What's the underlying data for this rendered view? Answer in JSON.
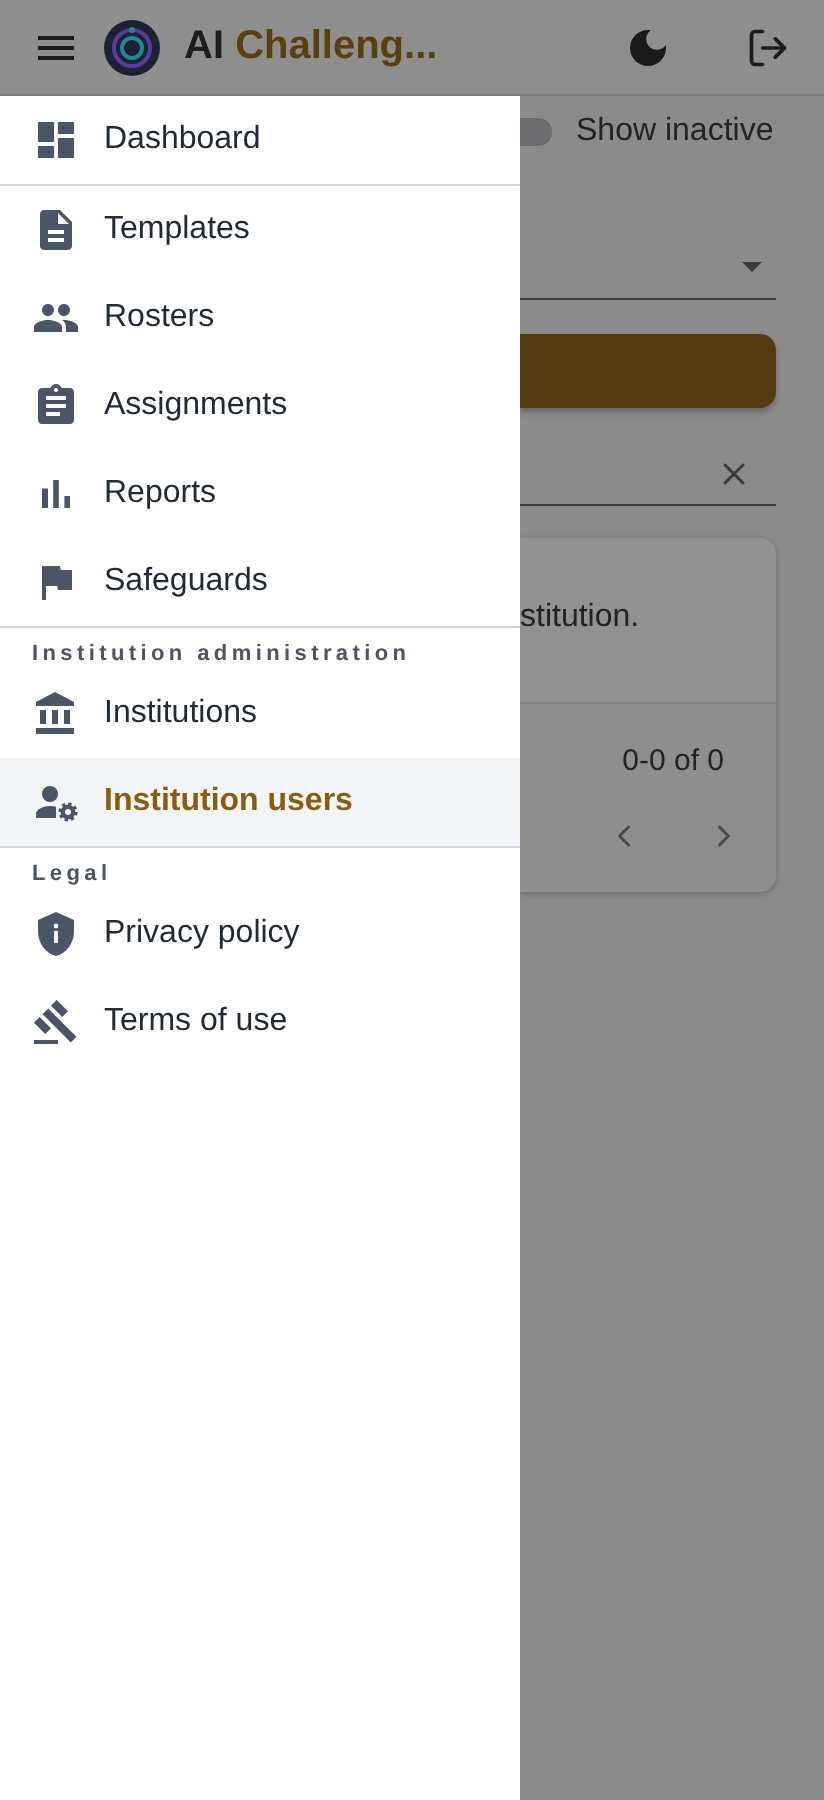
{
  "app_bar": {
    "title_prefix": "AI",
    "title_rest": "Challeng..."
  },
  "drawer": {
    "groups": [
      {
        "items": [
          {
            "label": "Dashboard",
            "selected": false
          }
        ]
      },
      {
        "items": [
          {
            "label": "Templates",
            "selected": false
          },
          {
            "label": "Rosters",
            "selected": false
          },
          {
            "label": "Assignments",
            "selected": false
          },
          {
            "label": "Reports",
            "selected": false
          },
          {
            "label": "Safeguards",
            "selected": false
          }
        ]
      },
      {
        "header": "Institution administration",
        "items": [
          {
            "label": "Institutions",
            "selected": false
          },
          {
            "label": "Institution users",
            "selected": true
          }
        ]
      },
      {
        "header": "Legal",
        "items": [
          {
            "label": "Privacy policy",
            "selected": false
          },
          {
            "label": "Terms of use",
            "selected": false
          }
        ]
      }
    ]
  },
  "background": {
    "show_inactive": {
      "label": "Show inactive",
      "on": false
    },
    "message": "stitution.",
    "pagination": "0-0 of 0"
  }
}
